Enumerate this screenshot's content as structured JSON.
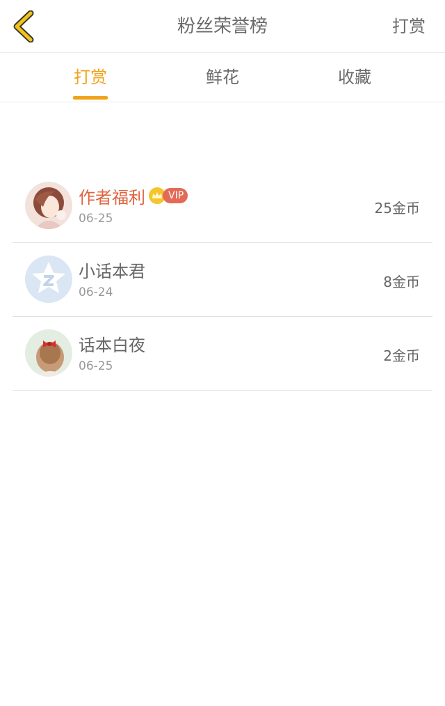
{
  "header": {
    "title": "粉丝荣誉榜",
    "action_label": "打赏",
    "back_icon": "chevron-left-icon"
  },
  "tabs": [
    {
      "label": "打赏",
      "active": true
    },
    {
      "label": "鲜花",
      "active": false
    },
    {
      "label": "收藏",
      "active": false
    }
  ],
  "fans": [
    {
      "name": "作者福利",
      "vip": true,
      "vip_label": "VIP",
      "date": "06-25",
      "amount": "25金币"
    },
    {
      "name": "小话本君",
      "vip": false,
      "date": "06-24",
      "amount": "8金币"
    },
    {
      "name": "话本白夜",
      "vip": false,
      "date": "06-25",
      "amount": "2金币"
    }
  ],
  "colors": {
    "accent": "#f0a31a",
    "vip_name": "#e0643f",
    "vip_badge": "#e36a57"
  }
}
